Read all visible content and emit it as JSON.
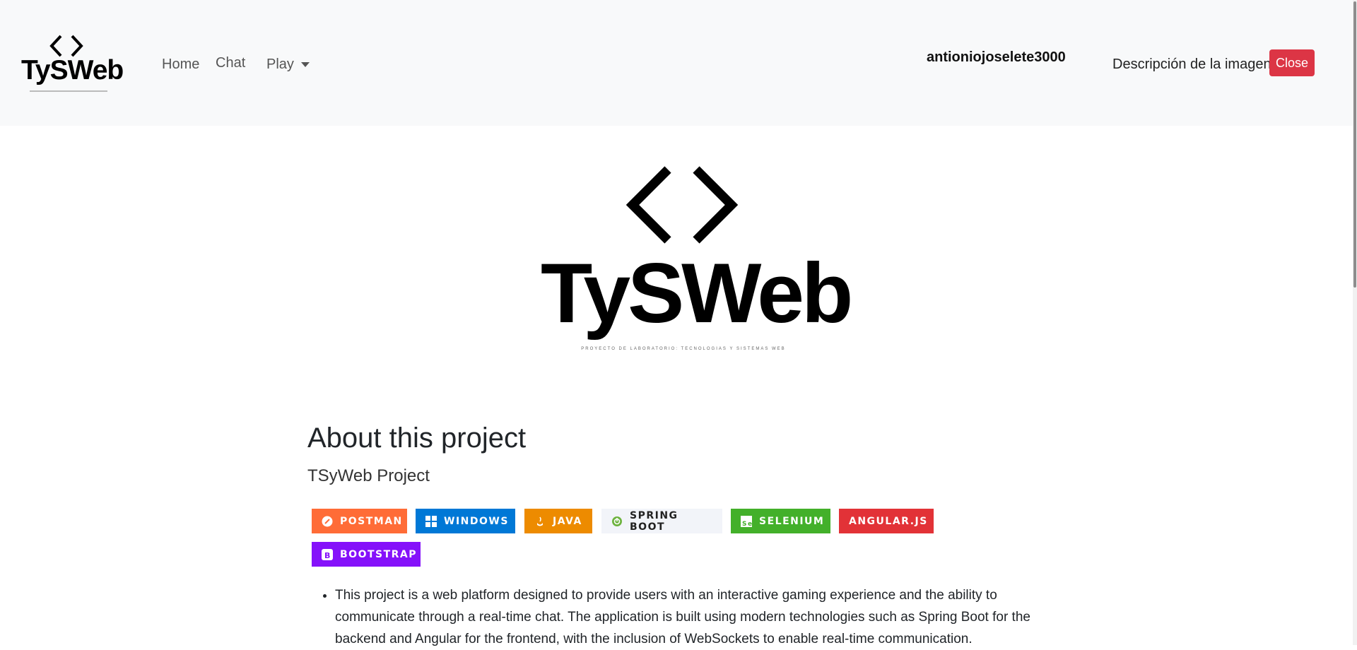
{
  "navbar": {
    "brand": {
      "name": "TySWeb",
      "tagline": "PROYECTO DE LABORATORIO: TECNOLOGIAS Y SISTEMAS WEB"
    },
    "links": [
      {
        "label": "Home"
      },
      {
        "label": "Chat"
      },
      {
        "label": "Play"
      }
    ],
    "username": "antioniojoselete3000",
    "image_alt": "Descripción de la imagen",
    "close_label": "Close"
  },
  "hero": {
    "name": "TySWeb",
    "tagline": "PROYECTO DE LABORATORIO: TECNOLOGIAS Y SISTEMAS WEB"
  },
  "about": {
    "title": "About this project",
    "subtitle": "TSyWeb Project",
    "badges": [
      {
        "label": "POSTMAN",
        "color": "#ff6c37",
        "icon": "postman-icon"
      },
      {
        "label": "WINDOWS",
        "color": "#0078d6",
        "icon": "windows-icon"
      },
      {
        "label": "JAVA",
        "color": "#ed8b00",
        "icon": "java-icon"
      },
      {
        "label": "SPRING BOOT",
        "color": "#f2f4f9",
        "icon": "spring-icon"
      },
      {
        "label": "SELENIUM",
        "color": "#43b02a",
        "icon": "selenium-icon"
      },
      {
        "label": "ANGULAR.JS",
        "color": "#e23237",
        "icon": "angular-icon"
      },
      {
        "label": "BOOTSTRAP",
        "color": "#8511fa",
        "icon": "bootstrap-icon"
      }
    ],
    "description": "This project is a web platform designed to provide users with an interactive gaming experience and the ability to communicate through a real-time chat. The application is built using modern technologies such as Spring Boot for the backend and Angular for the frontend, with the inclusion of WebSockets to enable real-time communication."
  }
}
